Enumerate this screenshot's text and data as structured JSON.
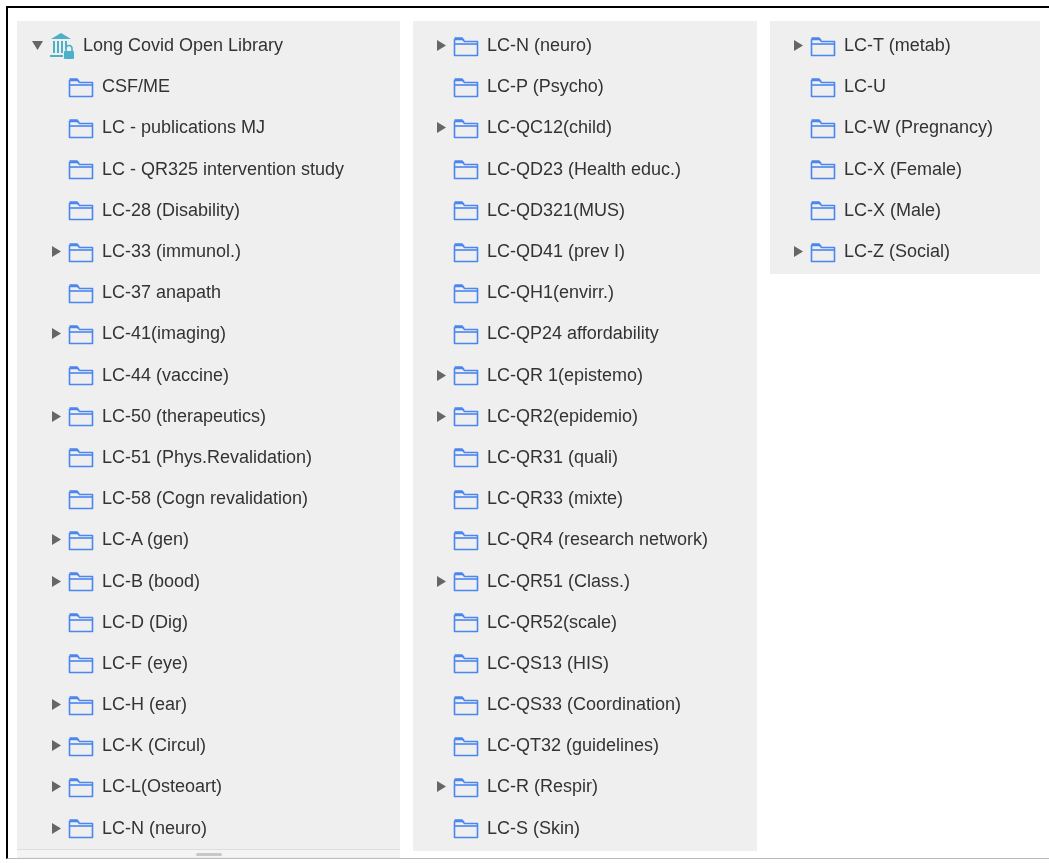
{
  "columns": [
    {
      "items": [
        {
          "kind": "library",
          "label": "Long Covid Open Library",
          "expanded": true,
          "children": [
            {
              "label": "CSF/ME",
              "expandable": false
            },
            {
              "label": "LC - publications MJ",
              "expandable": false
            },
            {
              "label": "LC - QR325 intervention study",
              "expandable": false
            },
            {
              "label": "LC-28 (Disability)",
              "expandable": false
            },
            {
              "label": "LC-33 (immunol.)",
              "expandable": true
            },
            {
              "label": "LC-37 anapath",
              "expandable": false
            },
            {
              "label": "LC-41(imaging)",
              "expandable": true
            },
            {
              "label": "LC-44 (vaccine)",
              "expandable": false
            },
            {
              "label": "LC-50 (therapeutics)",
              "expandable": true
            },
            {
              "label": "LC-51 (Phys.Revalidation)",
              "expandable": false
            },
            {
              "label": "LC-58 (Cogn revalidation)",
              "expandable": false
            },
            {
              "label": "LC-A (gen)",
              "expandable": true
            },
            {
              "label": "LC-B (bood)",
              "expandable": true
            },
            {
              "label": "LC-D (Dig)",
              "expandable": false
            },
            {
              "label": "LC-F (eye)",
              "expandable": false
            },
            {
              "label": "LC-H (ear)",
              "expandable": true
            },
            {
              "label": "LC-K (Circul)",
              "expandable": true
            },
            {
              "label": "LC-L(Osteoart)",
              "expandable": true
            },
            {
              "label": "LC-N (neuro)",
              "expandable": true
            }
          ]
        }
      ]
    },
    {
      "items": [
        {
          "label": "LC-N (neuro)",
          "expandable": true
        },
        {
          "label": "LC-P (Psycho)",
          "expandable": false
        },
        {
          "label": "LC-QC12(child)",
          "expandable": true
        },
        {
          "label": "LC-QD23 (Health educ.)",
          "expandable": false
        },
        {
          "label": "LC-QD321(MUS)",
          "expandable": false
        },
        {
          "label": "LC-QD41 (prev I)",
          "expandable": false
        },
        {
          "label": "LC-QH1(envirr.)",
          "expandable": false
        },
        {
          "label": "LC-QP24 affordability",
          "expandable": false
        },
        {
          "label": "LC-QR 1(epistemo)",
          "expandable": true
        },
        {
          "label": "LC-QR2(epidemio)",
          "expandable": true
        },
        {
          "label": "LC-QR31 (quali)",
          "expandable": false
        },
        {
          "label": "LC-QR33 (mixte)",
          "expandable": false
        },
        {
          "label": "LC-QR4 (research network)",
          "expandable": false
        },
        {
          "label": "LC-QR51 (Class.)",
          "expandable": true
        },
        {
          "label": "LC-QR52(scale)",
          "expandable": false
        },
        {
          "label": "LC-QS13 (HIS)",
          "expandable": false
        },
        {
          "label": "LC-QS33 (Coordination)",
          "expandable": false
        },
        {
          "label": "LC-QT32 (guidelines)",
          "expandable": false
        },
        {
          "label": "LC-R (Respir)",
          "expandable": true
        },
        {
          "label": "LC-S (Skin)",
          "expandable": false
        }
      ]
    },
    {
      "items": [
        {
          "label": "LC-T (metab)",
          "expandable": true
        },
        {
          "label": "LC-U",
          "expandable": false
        },
        {
          "label": "LC-W (Pregnancy)",
          "expandable": false
        },
        {
          "label": "LC-X (Female)",
          "expandable": false
        },
        {
          "label": "LC-X (Male)",
          "expandable": false
        },
        {
          "label": "LC-Z (Social)",
          "expandable": true
        }
      ]
    }
  ]
}
